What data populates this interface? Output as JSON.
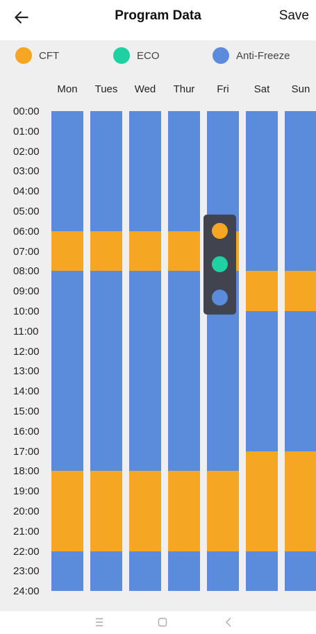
{
  "header": {
    "title": "Program Data",
    "save_label": "Save",
    "back_icon": "arrow-left-icon"
  },
  "legend": [
    {
      "label": "CFT",
      "color": "#f5a623"
    },
    {
      "label": "ECO",
      "color": "#1ed0a2"
    },
    {
      "label": "Anti-Freeze",
      "color": "#5b8bdb"
    }
  ],
  "days": [
    "Mon",
    "Tues",
    "Wed",
    "Thur",
    "Fri",
    "Sat",
    "Sun"
  ],
  "times": [
    "00:00",
    "01:00",
    "02:00",
    "03:00",
    "04:00",
    "05:00",
    "06:00",
    "07:00",
    "08:00",
    "09:00",
    "10:00",
    "11:00",
    "12:00",
    "13:00",
    "14:00",
    "15:00",
    "16:00",
    "17:00",
    "18:00",
    "19:00",
    "20:00",
    "21:00",
    "22:00",
    "23:00",
    "24:00"
  ],
  "schedule": [
    [
      {
        "mode": "Anti-Freeze",
        "from": 0,
        "to": 6
      },
      {
        "mode": "CFT",
        "from": 6,
        "to": 8
      },
      {
        "mode": "Anti-Freeze",
        "from": 8,
        "to": 18
      },
      {
        "mode": "CFT",
        "from": 18,
        "to": 22
      },
      {
        "mode": "Anti-Freeze",
        "from": 22,
        "to": 24
      }
    ],
    [
      {
        "mode": "Anti-Freeze",
        "from": 0,
        "to": 6
      },
      {
        "mode": "CFT",
        "from": 6,
        "to": 8
      },
      {
        "mode": "Anti-Freeze",
        "from": 8,
        "to": 18
      },
      {
        "mode": "CFT",
        "from": 18,
        "to": 22
      },
      {
        "mode": "Anti-Freeze",
        "from": 22,
        "to": 24
      }
    ],
    [
      {
        "mode": "Anti-Freeze",
        "from": 0,
        "to": 6
      },
      {
        "mode": "CFT",
        "from": 6,
        "to": 8
      },
      {
        "mode": "Anti-Freeze",
        "from": 8,
        "to": 18
      },
      {
        "mode": "CFT",
        "from": 18,
        "to": 22
      },
      {
        "mode": "Anti-Freeze",
        "from": 22,
        "to": 24
      }
    ],
    [
      {
        "mode": "Anti-Freeze",
        "from": 0,
        "to": 6
      },
      {
        "mode": "CFT",
        "from": 6,
        "to": 8
      },
      {
        "mode": "Anti-Freeze",
        "from": 8,
        "to": 18
      },
      {
        "mode": "CFT",
        "from": 18,
        "to": 22
      },
      {
        "mode": "Anti-Freeze",
        "from": 22,
        "to": 24
      }
    ],
    [
      {
        "mode": "Anti-Freeze",
        "from": 0,
        "to": 6
      },
      {
        "mode": "CFT",
        "from": 6,
        "to": 8
      },
      {
        "mode": "Anti-Freeze",
        "from": 8,
        "to": 18
      },
      {
        "mode": "CFT",
        "from": 18,
        "to": 22
      },
      {
        "mode": "Anti-Freeze",
        "from": 22,
        "to": 24
      }
    ],
    [
      {
        "mode": "Anti-Freeze",
        "from": 0,
        "to": 8
      },
      {
        "mode": "CFT",
        "from": 8,
        "to": 10
      },
      {
        "mode": "Anti-Freeze",
        "from": 10,
        "to": 17
      },
      {
        "mode": "CFT",
        "from": 17,
        "to": 22
      },
      {
        "mode": "Anti-Freeze",
        "from": 22,
        "to": 24
      }
    ],
    [
      {
        "mode": "Anti-Freeze",
        "from": 0,
        "to": 8
      },
      {
        "mode": "CFT",
        "from": 8,
        "to": 10
      },
      {
        "mode": "Anti-Freeze",
        "from": 10,
        "to": 17
      },
      {
        "mode": "CFT",
        "from": 17,
        "to": 22
      },
      {
        "mode": "Anti-Freeze",
        "from": 22,
        "to": 24
      }
    ]
  ],
  "mode_picker": {
    "options": [
      {
        "mode": "CFT",
        "color": "#f5a623"
      },
      {
        "mode": "ECO",
        "color": "#1ed0a2"
      },
      {
        "mode": "Anti-Freeze",
        "color": "#5b8bdb"
      }
    ]
  },
  "navbar": {
    "icons": [
      "menu-icon",
      "home-square-icon",
      "back-chevron-icon"
    ]
  }
}
